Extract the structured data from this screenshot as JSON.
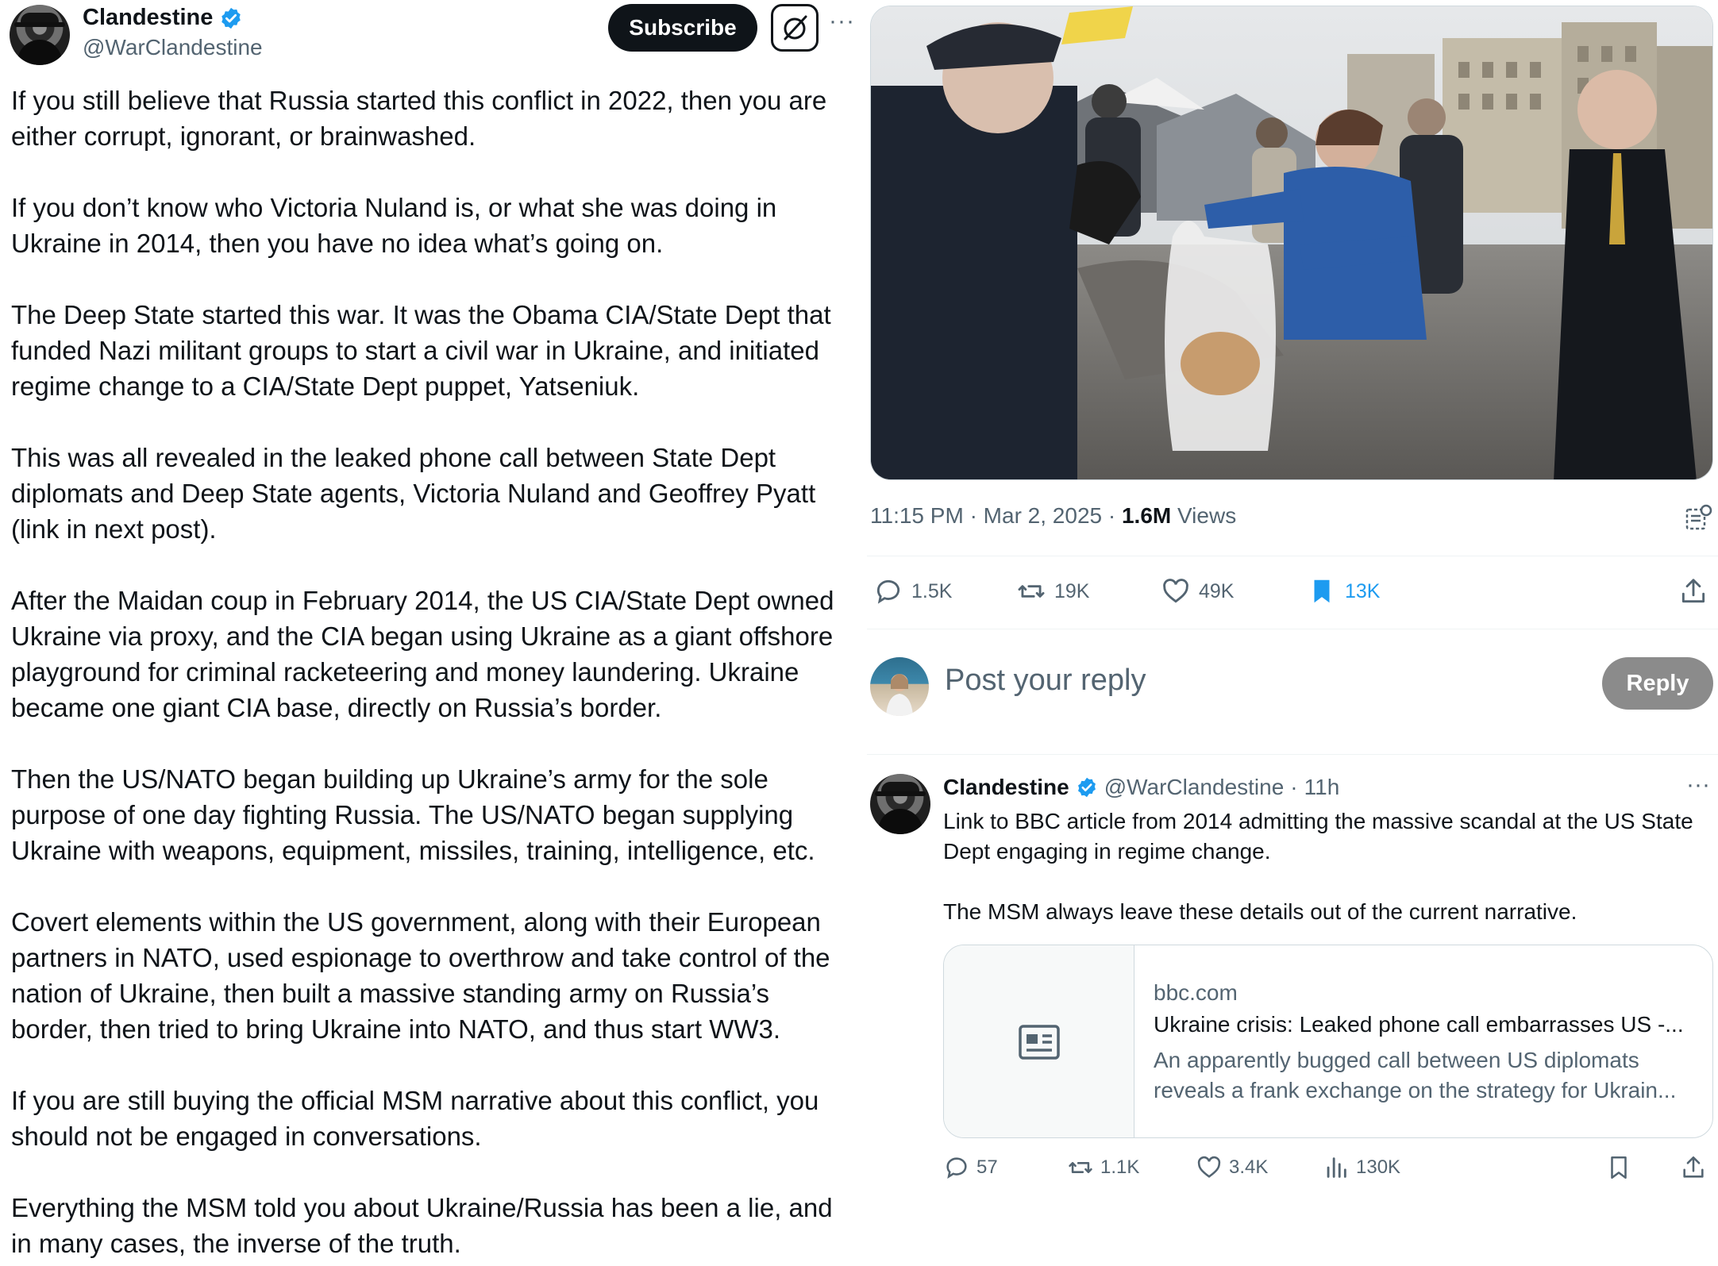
{
  "author": {
    "name": "Clandestine",
    "handle": "@WarClandestine"
  },
  "header_buttons": {
    "subscribe_label": "Subscribe",
    "more": "···"
  },
  "post": {
    "paragraphs": [
      "If you still believe that Russia started this conflict in 2022, then you are either corrupt, ignorant, or brainwashed.",
      "If you don’t know who Victoria Nuland is, or what she was doing in Ukraine in 2014, then you have no idea what’s going on.",
      "The Deep State started this war. It was the Obama CIA/State Dept that funded Nazi militant groups to start a civil war in Ukraine, and initiated regime change to a CIA/State Dept puppet, Yatseniuk.",
      "This was all revealed in the leaked phone call between State Dept diplomats and Deep State agents, Victoria Nuland and Geoffrey Pyatt (link in next post).",
      "After the Maidan coup in February 2014, the US CIA/State Dept owned Ukraine via proxy, and the CIA began using Ukraine as a giant offshore playground for criminal racketeering and money laundering. Ukraine became one giant CIA base, directly on Russia’s border.",
      "Then the US/NATO began building up Ukraine’s army for the sole purpose of one day fighting Russia. The US/NATO began supplying Ukraine with weapons, equipment, missiles, training, intelligence, etc.",
      "Covert elements within the US government, along with their European partners in NATO, used espionage to overthrow and take control of the nation of Ukraine, then built a massive standing army on Russia’s border, then tried to bring Ukraine into NATO, and thus start WW3.",
      "If you are still buying the official MSM narrative about this conflict, you should not be engaged in conversations.",
      "Everything the MSM told you about Ukraine/Russia has been a lie, and in many cases, the inverse of the truth."
    ],
    "time": "11:15 PM",
    "date": "Mar 2, 2025",
    "views_count": "1.6M",
    "views_label": "Views",
    "separator": "·",
    "stats": {
      "replies": "1.5K",
      "reposts": "19K",
      "likes": "49K",
      "bookmarks": "13K"
    }
  },
  "reply_composer": {
    "placeholder": "Post your reply",
    "button_label": "Reply"
  },
  "reply_tweet": {
    "name": "Clandestine",
    "handle": "@WarClandestine",
    "time": "11h",
    "separator": "·",
    "more": "···",
    "paragraphs": [
      "Link to BBC article from 2014 admitting the massive scandal at the US State Dept engaging in regime change.",
      "The MSM always leave these details out of the current narrative."
    ],
    "card": {
      "domain": "bbc.com",
      "title": "Ukraine crisis: Leaked phone call embarrasses US -...",
      "description": "An apparently bugged call between US diplomats reveals a frank exchange on the strategy for Ukrain..."
    },
    "stats": {
      "replies": "57",
      "reposts": "1.1K",
      "likes": "3.4K",
      "views": "130K"
    }
  },
  "colors": {
    "text": "#0f1419",
    "muted": "#536471",
    "verified": "#1d9bf0",
    "bookmark_active": "#1d9bf0"
  }
}
